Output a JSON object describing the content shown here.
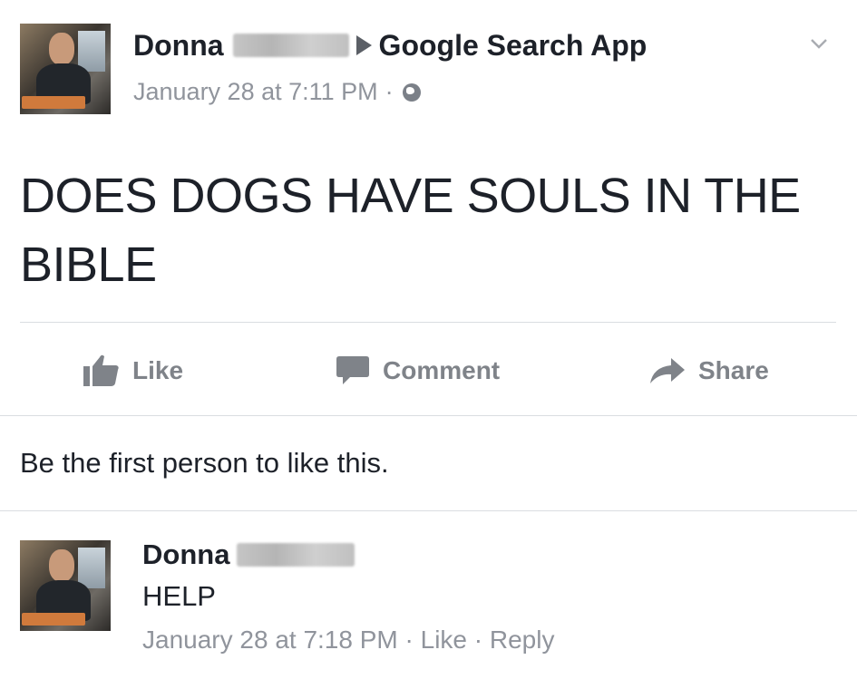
{
  "post": {
    "author": "Donna",
    "target": "Google Search App",
    "timestamp": "January 28 at 7:11 PM",
    "separator": "·",
    "body": "DOES DOGS HAVE SOULS IN THE BIBLE"
  },
  "actions": {
    "like": "Like",
    "comment": "Comment",
    "share": "Share"
  },
  "likes_text": "Be the first person to like this.",
  "comment": {
    "author": "Donna",
    "text": "HELP",
    "timestamp": "January 28 at 7:18 PM",
    "like": "Like",
    "reply": "Reply",
    "separator": "·"
  },
  "colors": {
    "text": "#1d2129",
    "meta": "#90949c",
    "action": "#7f8389",
    "divider": "#dadde1"
  }
}
